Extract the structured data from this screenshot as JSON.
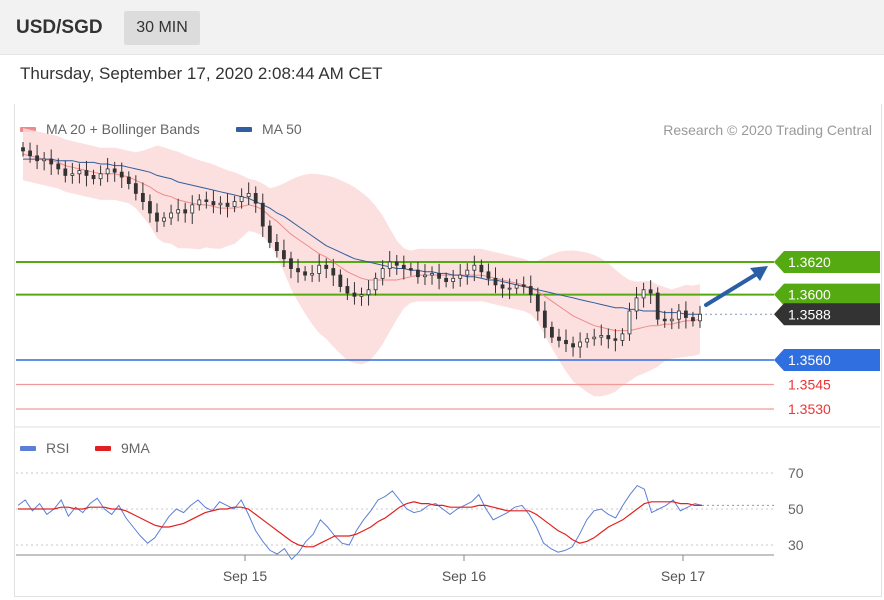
{
  "header": {
    "symbol": "USD/SGD",
    "interval": "30 MIN"
  },
  "datetime": "Thursday, September 17, 2020 2:08:44 AM CET",
  "legend": {
    "ma20": {
      "label": "MA 20 + Bollinger Bands",
      "color": "#f08a8a"
    },
    "ma50": {
      "label": "MA 50",
      "color": "#2f5f9e"
    },
    "credit": "Research © 2020 Trading Central"
  },
  "rsi_legend": {
    "rsi": {
      "label": "RSI",
      "color": "#5b7fd6"
    },
    "ma9": {
      "label": "9MA",
      "color": "#e02020"
    }
  },
  "colors": {
    "resistance": "#55aa11",
    "support": "#2f6fe0",
    "target": "#ee3333",
    "current": "#333333",
    "arrow": "#2a5fa6",
    "band": "#fbd9d9",
    "candle": "#333333"
  },
  "chart_data": [
    {
      "type": "candlestick",
      "levels": [
        {
          "value": 1.362,
          "label": "1.3620",
          "kind": "resistance"
        },
        {
          "value": 1.36,
          "label": "1.3600",
          "kind": "resistance"
        },
        {
          "value": 1.3588,
          "label": "1.3588",
          "kind": "current"
        },
        {
          "value": 1.356,
          "label": "1.3560",
          "kind": "support"
        },
        {
          "value": 1.3545,
          "label": "1.3545",
          "kind": "target"
        },
        {
          "value": 1.353,
          "label": "1.3530",
          "kind": "target"
        }
      ],
      "x_ticks": [
        "Sep 15",
        "Sep 16",
        "Sep 17"
      ],
      "close": [
        1.3688,
        1.3685,
        1.3682,
        1.3683,
        1.368,
        1.3677,
        1.3673,
        1.3674,
        1.3676,
        1.3673,
        1.3671,
        1.3674,
        1.3677,
        1.3675,
        1.3672,
        1.3668,
        1.3662,
        1.3657,
        1.365,
        1.3645,
        1.3647,
        1.365,
        1.3652,
        1.365,
        1.3655,
        1.3658,
        1.3657,
        1.3655,
        1.3656,
        1.3654,
        1.3657,
        1.366,
        1.3662,
        1.3656,
        1.3642,
        1.3632,
        1.3627,
        1.3622,
        1.3616,
        1.3614,
        1.3612,
        1.3613,
        1.3618,
        1.3616,
        1.3612,
        1.3605,
        1.3601,
        1.3599,
        1.36,
        1.3603,
        1.361,
        1.3616,
        1.362,
        1.3618,
        1.3616,
        1.3615,
        1.3611,
        1.3612,
        1.3613,
        1.361,
        1.3608,
        1.361,
        1.3612,
        1.3615,
        1.3618,
        1.3614,
        1.361,
        1.3606,
        1.3604,
        1.3604,
        1.3606,
        1.3605,
        1.36,
        1.359,
        1.358,
        1.3574,
        1.3572,
        1.357,
        1.3568,
        1.3571,
        1.3573,
        1.3574,
        1.3575,
        1.3573,
        1.3572,
        1.3576,
        1.359,
        1.3598,
        1.3603,
        1.3601,
        1.3585,
        1.3584,
        1.3585,
        1.359,
        1.3586,
        1.3584,
        1.3588
      ],
      "ma20": [
        1.3686,
        1.3685,
        1.3684,
        1.3683,
        1.3682,
        1.3681,
        1.3679,
        1.3678,
        1.3677,
        1.3676,
        1.3675,
        1.3674,
        1.3674,
        1.3674,
        1.3673,
        1.3672,
        1.367,
        1.3668,
        1.3666,
        1.3663,
        1.3661,
        1.366,
        1.3658,
        1.3657,
        1.3656,
        1.3655,
        1.3655,
        1.3654,
        1.3653,
        1.3653,
        1.3653,
        1.3654,
        1.3655,
        1.3654,
        1.3652,
        1.3648,
        1.3645,
        1.3641,
        1.3637,
        1.3634,
        1.3631,
        1.3628,
        1.3625,
        1.3623,
        1.362,
        1.3617,
        1.3614,
        1.3612,
        1.361,
        1.3609,
        1.3609,
        1.3609,
        1.3609,
        1.3609,
        1.361,
        1.3611,
        1.3612,
        1.3612,
        1.3612,
        1.3612,
        1.3612,
        1.3612,
        1.3612,
        1.3612,
        1.3612,
        1.3612,
        1.3611,
        1.361,
        1.3609,
        1.3608,
        1.3607,
        1.3606,
        1.3604,
        1.3602,
        1.3599,
        1.3596,
        1.3593,
        1.359,
        1.3587,
        1.3585,
        1.3583,
        1.3581,
        1.358,
        1.3579,
        1.3578,
        1.3578,
        1.3578,
        1.3579,
        1.358,
        1.3581,
        1.3581,
        1.3582,
        1.3582,
        1.3583,
        1.3584,
        1.3584,
        1.3585
      ],
      "ma50": [
        1.3683,
        1.3683,
        1.3683,
        1.3683,
        1.3683,
        1.3682,
        1.3682,
        1.3682,
        1.3681,
        1.3681,
        1.3681,
        1.368,
        1.368,
        1.3679,
        1.3679,
        1.3678,
        1.3677,
        1.3676,
        1.3675,
        1.3673,
        1.3672,
        1.3671,
        1.3669,
        1.3668,
        1.3667,
        1.3666,
        1.3665,
        1.3664,
        1.3663,
        1.3662,
        1.3661,
        1.366,
        1.3659,
        1.3657,
        1.3655,
        1.3653,
        1.365,
        1.3648,
        1.3645,
        1.3642,
        1.3639,
        1.3636,
        1.3633,
        1.363,
        1.3628,
        1.3626,
        1.3624,
        1.3622,
        1.3621,
        1.362,
        1.3619,
        1.3618,
        1.3617,
        1.3616,
        1.3616,
        1.3615,
        1.3615,
        1.3614,
        1.3614,
        1.3613,
        1.3613,
        1.3612,
        1.3612,
        1.3611,
        1.3611,
        1.361,
        1.3609,
        1.3609,
        1.3608,
        1.3607,
        1.3606,
        1.3605,
        1.3604,
        1.3603,
        1.3602,
        1.3601,
        1.36,
        1.3599,
        1.3598,
        1.3597,
        1.3596,
        1.3595,
        1.3594,
        1.3593,
        1.3592,
        1.3592,
        1.3591,
        1.3591,
        1.359,
        1.359,
        1.359,
        1.3589,
        1.3589,
        1.3589,
        1.3588,
        1.3588,
        1.3588
      ],
      "forecast": {
        "from": 1.359,
        "to": 1.362
      }
    },
    {
      "type": "line",
      "name": "RSI",
      "y_ticks": [
        "70",
        "50",
        "30"
      ],
      "ylim": [
        20,
        80
      ],
      "rsi": [
        52,
        55,
        49,
        53,
        47,
        50,
        55,
        46,
        51,
        48,
        53,
        56,
        50,
        47,
        52,
        45,
        40,
        35,
        31,
        34,
        40,
        46,
        50,
        48,
        52,
        55,
        51,
        49,
        54,
        52,
        50,
        55,
        47,
        38,
        32,
        27,
        25,
        28,
        22,
        26,
        32,
        36,
        44,
        40,
        35,
        31,
        30,
        38,
        44,
        49,
        55,
        57,
        60,
        55,
        50,
        48,
        49,
        52,
        53,
        50,
        47,
        50,
        52,
        54,
        58,
        50,
        44,
        46,
        48,
        51,
        52,
        47,
        40,
        31,
        28,
        26,
        27,
        29,
        36,
        44,
        49,
        50,
        47,
        45,
        52,
        58,
        63,
        61,
        48,
        50,
        52,
        55,
        49,
        51,
        53,
        52
      ],
      "ma9": [
        50,
        50,
        50,
        50,
        50,
        50,
        51,
        51,
        50,
        50,
        51,
        51,
        51,
        50,
        50,
        49,
        47,
        45,
        43,
        41,
        40,
        40,
        41,
        42,
        44,
        46,
        48,
        49,
        50,
        50,
        51,
        51,
        50,
        47,
        44,
        41,
        38,
        35,
        32,
        30,
        29,
        29,
        31,
        33,
        35,
        35,
        35,
        36,
        38,
        40,
        43,
        45,
        48,
        51,
        53,
        54,
        53,
        53,
        52,
        52,
        51,
        51,
        51,
        51,
        52,
        52,
        51,
        50,
        49,
        49,
        49,
        49,
        47,
        44,
        41,
        38,
        36,
        33,
        31,
        32,
        34,
        37,
        40,
        42,
        44,
        47,
        50,
        53,
        54,
        54,
        54,
        54,
        53,
        53,
        52,
        52
      ]
    }
  ]
}
